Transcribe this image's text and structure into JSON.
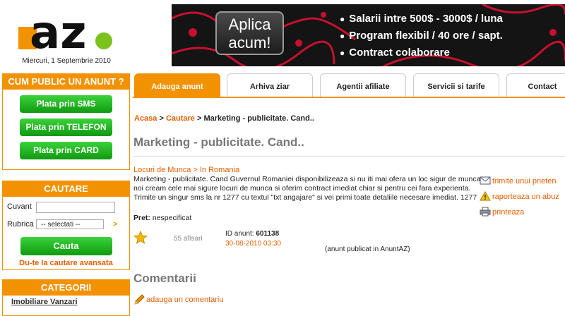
{
  "header": {
    "logo_text": "az",
    "date": "Miercuri, 1 Septembrie 2010",
    "banner": {
      "apply_line1": "Aplica",
      "apply_line2": "acum!",
      "bullets": [
        "Salarii intre 500$ - 3000$ / luna",
        "Program flexibil / 40 ore / sapt.",
        "Contract colaborare"
      ]
    }
  },
  "sidebar": {
    "publish": {
      "title": "CUM PUBLIC UN ANUNT ?",
      "buttons": [
        "Plata prin SMS",
        "Plata prin TELEFON",
        "Plata prin CARD"
      ]
    },
    "search": {
      "title": "CAUTARE",
      "keyword_label": "Cuvant",
      "keyword_value": "",
      "category_label": "Rubrica",
      "category_selected": "-- selectati --",
      "go_symbol": ">",
      "search_button": "Cauta",
      "advanced_link": "Du-te la cautare avansata"
    },
    "categories": {
      "title": "CATEGORII",
      "first_item": "Imobiliare Vanzari"
    }
  },
  "tabs": [
    "Adauga anunt",
    "Arhiva ziar",
    "Agentii afiliate",
    "Servicii si tarife",
    "Contact"
  ],
  "breadcrumb": {
    "home": "Acasa",
    "sep1": " > ",
    "section": "Cautare",
    "sep2": " > ",
    "current": "Marketing - publicitate. Cand.."
  },
  "ad": {
    "title": "Marketing - publicitate. Cand..",
    "category_path": "Locuri de Munca > In Romania",
    "body": "Marketing - publicitate. Cand Guvernul Romaniei disponibilizeaza si nu iti mai ofera un loc sigur de munca noi cream cele mai sigure locuri de munca si oferim contract imediat chiar si pentru cei fara experienta. Trimite un singur sms la nr 1277 cu textul \"txt angajare\" si vei primi toate detaliile necesare imediat. 1277",
    "price_label": "Pret:",
    "price_value": " nespecificat",
    "views": "55 afisari",
    "id_label": "ID anunt: ",
    "id_value": "601138",
    "date": "30-08-2010 03:30",
    "published_in": "(anunt publicat in AnuntAZ)",
    "actions": {
      "send": "trimite unui prieten",
      "report": "raporteaza un abuz",
      "print": "printeaza"
    }
  },
  "comments": {
    "title": "Comentarii",
    "add_link": "adauga un comentariu"
  },
  "colors": {
    "accent": "#f39200",
    "link": "#e85d00",
    "green": "#1fb51f"
  }
}
